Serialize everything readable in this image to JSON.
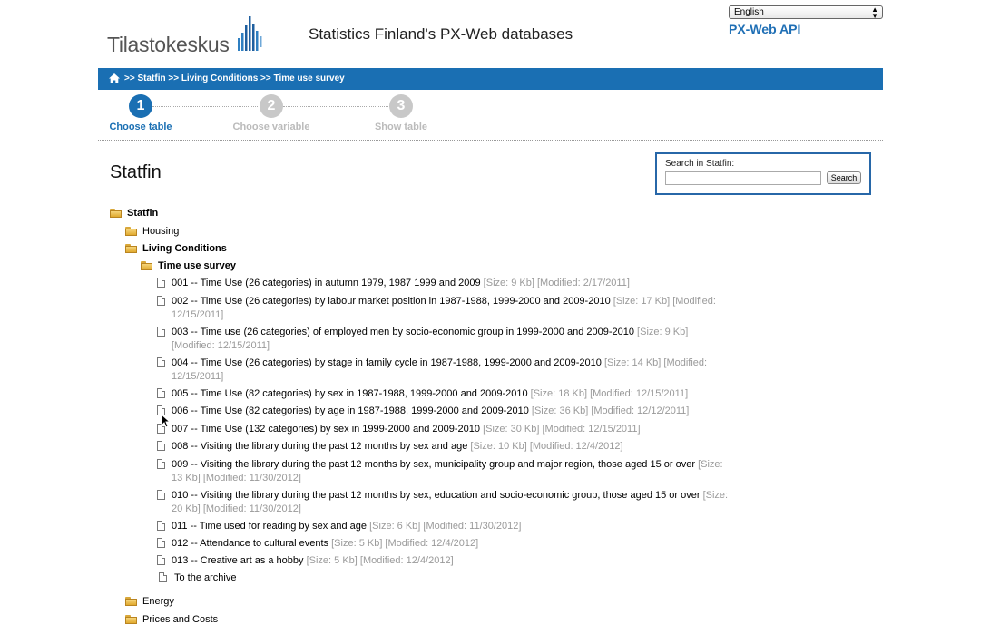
{
  "header": {
    "logo_text": "Tilastokeskus",
    "site_title": "Statistics Finland's PX-Web databases",
    "language_selected": "English",
    "api_link": "PX-Web API"
  },
  "breadcrumb": {
    "sep": ">>",
    "items": [
      "Statfin",
      "Living Conditions",
      "Time use survey"
    ]
  },
  "steps": [
    {
      "number": "1",
      "label": "Choose table",
      "state": "active"
    },
    {
      "number": "2",
      "label": "Choose variable",
      "state": "inactive"
    },
    {
      "number": "3",
      "label": "Show table",
      "state": "inactive"
    }
  ],
  "page_title": "Statfin",
  "search": {
    "label": "Search in Statfin:",
    "button": "Search",
    "value": ""
  },
  "tree": {
    "root": "Statfin",
    "level1_before": [
      "Housing",
      "Living Conditions"
    ],
    "level2": "Time use survey",
    "tables": [
      {
        "text": "001 -- Time Use (26 categories) in autumn 1979, 1987 1999 and 2009",
        "meta": "[Size: 9 Kb] [Modified: 2/17/2011]"
      },
      {
        "text": "002 -- Time Use (26 categories) by labour market position in 1987-1988, 1999-2000 and 2009-2010",
        "meta": "[Size: 17 Kb] [Modified: 12/15/2011]"
      },
      {
        "text": "003 -- Time use (26 categories) of employed men by socio-economic group in 1999-2000 and 2009-2010",
        "meta": "[Size: 9 Kb] [Modified: 12/15/2011]"
      },
      {
        "text": "004 -- Time Use (26 categories) by stage in family cycle in 1987-1988, 1999-2000 and 2009-2010",
        "meta": "[Size: 14 Kb] [Modified: 12/15/2011]"
      },
      {
        "text": "005 -- Time Use (82 categories) by sex in 1987-1988, 1999-2000 and 2009-2010",
        "meta": "[Size: 18 Kb] [Modified: 12/15/2011]"
      },
      {
        "text": "006 -- Time Use (82 categories) by age in 1987-1988, 1999-2000 and 2009-2010",
        "meta": "[Size: 36 Kb] [Modified: 12/12/2011]"
      },
      {
        "text": "007 -- Time Use (132 categories) by sex in 1999-2000 and 2009-2010",
        "meta": "[Size: 30 Kb] [Modified: 12/15/2011]"
      },
      {
        "text": "008 -- Visiting the library during the past 12 months by sex and age",
        "meta": "[Size: 10 Kb] [Modified: 12/4/2012]"
      },
      {
        "text": "009 -- Visiting the library during the past 12 months by sex, municipality group and major region, those aged 15 or over",
        "meta": "[Size: 13 Kb] [Modified: 11/30/2012]"
      },
      {
        "text": "010 -- Visiting the library during the past 12 months by sex, education and socio-economic group, those aged 15 or over",
        "meta": "[Size: 20 Kb] [Modified: 11/30/2012]"
      },
      {
        "text": "011 -- Time used for reading by sex and age",
        "meta": "[Size: 6 Kb] [Modified: 11/30/2012]"
      },
      {
        "text": "012 -- Attendance to cultural events",
        "meta": "[Size: 5 Kb] [Modified: 12/4/2012]"
      },
      {
        "text": "013 -- Creative art as a hobby",
        "meta": "[Size: 5 Kb] [Modified: 12/4/2012]"
      },
      {
        "text": "To the archive",
        "meta": ""
      }
    ],
    "level1_after": [
      "Energy",
      "Prices and Costs"
    ]
  }
}
